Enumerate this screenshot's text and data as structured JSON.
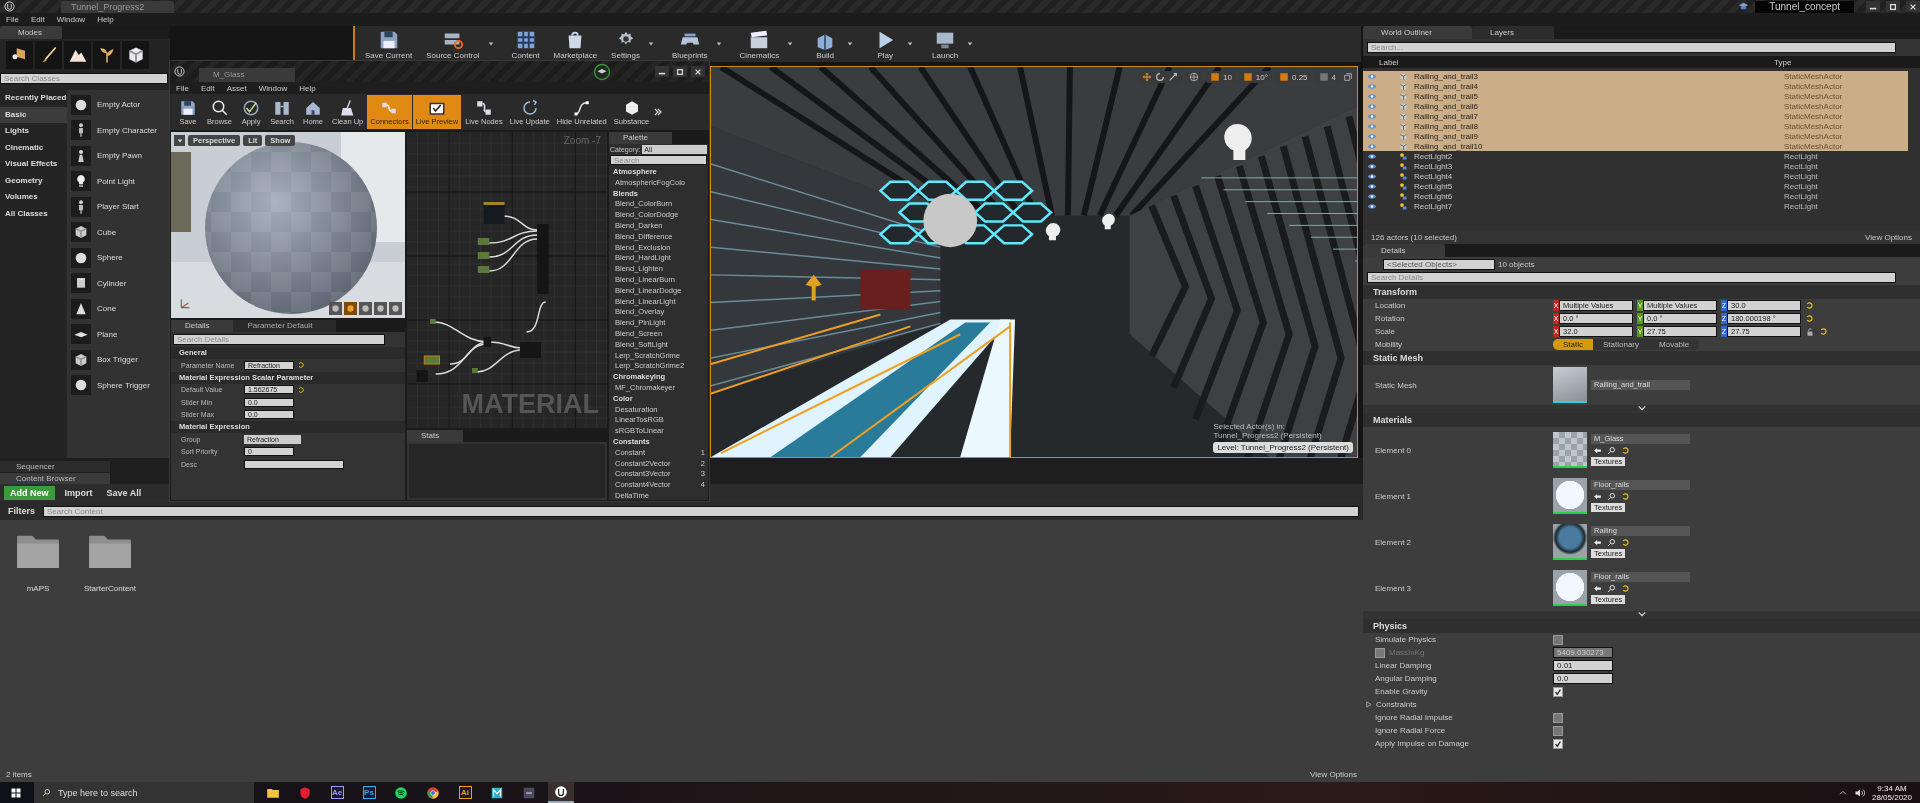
{
  "title_bar": {
    "tab": "Tunnel_Progress2",
    "project": "Tunnel_concept"
  },
  "menu": [
    "File",
    "Edit",
    "Window",
    "Help"
  ],
  "modes": {
    "tab": "Modes",
    "tools": [
      {
        "kind": "place"
      },
      {
        "kind": "paint"
      },
      {
        "kind": "landscape"
      },
      {
        "kind": "foliage"
      },
      {
        "kind": "geometry"
      }
    ],
    "search": {
      "placeholder": "Search Classes"
    },
    "categories": [
      {
        "label": "Recently Placed",
        "selected": false
      },
      {
        "label": "Basic",
        "selected": true
      },
      {
        "label": "Lights",
        "selected": false
      },
      {
        "label": "Cinematic",
        "selected": false
      },
      {
        "label": "Visual Effects",
        "selected": false
      },
      {
        "label": "Geometry",
        "selected": false
      },
      {
        "label": "Volumes",
        "selected": false
      },
      {
        "label": "All Classes",
        "selected": false
      }
    ],
    "items": [
      {
        "label": "Empty Actor",
        "kind": "sphere"
      },
      {
        "label": "Empty Character",
        "kind": "figure"
      },
      {
        "label": "Empty Pawn",
        "kind": "pawn"
      },
      {
        "label": "Point Light",
        "kind": "bulb"
      },
      {
        "label": "Player Start",
        "kind": "figure"
      },
      {
        "label": "Cube",
        "kind": "cube"
      },
      {
        "label": "Sphere",
        "kind": "sphere"
      },
      {
        "label": "Cylinder",
        "kind": "cylinder"
      },
      {
        "label": "Cone",
        "kind": "cone"
      },
      {
        "label": "Plane",
        "kind": "plane"
      },
      {
        "label": "Box Trigger",
        "kind": "cube"
      },
      {
        "label": "Sphere Trigger",
        "kind": "sphere"
      }
    ]
  },
  "toolbar": [
    {
      "label": "Save Current",
      "kind": "save",
      "dropdown": false
    },
    {
      "label": "Source Control",
      "kind": "source-control",
      "dropdown": true
    },
    {
      "label": "Content",
      "kind": "content",
      "dropdown": false
    },
    {
      "label": "Marketplace",
      "kind": "marketplace",
      "dropdown": false
    },
    {
      "label": "Settings",
      "kind": "settings",
      "dropdown": true
    },
    {
      "label": "Blueprints",
      "kind": "blueprints",
      "dropdown": true
    },
    {
      "label": "Cinematics",
      "kind": "cinematics",
      "dropdown": true
    },
    {
      "label": "Build",
      "kind": "build",
      "dropdown": true
    },
    {
      "label": "Play",
      "kind": "play",
      "dropdown": true
    },
    {
      "label": "Launch",
      "kind": "launch",
      "dropdown": true
    }
  ],
  "viewport": {
    "snap_values": [
      "10",
      "10°",
      "0.25",
      "4"
    ],
    "selection_info": "Selected Actor(s) in:",
    "selection_level": "Tunnel_Progress2 (Persistent)",
    "level_badge": "Level:  Tunnel_Progress2 (Persistent)"
  },
  "material_editor": {
    "tab": "M_Glass",
    "menu": [
      "File",
      "Edit",
      "Asset",
      "Window",
      "Help"
    ],
    "toolbar": [
      {
        "label": "Save",
        "kind": "save",
        "on": false
      },
      {
        "label": "Browse",
        "kind": "browse",
        "on": false
      },
      {
        "label": "Apply",
        "kind": "apply",
        "on": false
      },
      {
        "label": "Search",
        "kind": "search",
        "on": false
      },
      {
        "label": "Home",
        "kind": "home",
        "on": false
      },
      {
        "label": "Clean Up",
        "kind": "clean-up",
        "on": false
      },
      {
        "label": "Connectors",
        "kind": "connectors",
        "on": true
      },
      {
        "label": "Live Preview",
        "kind": "live-preview",
        "on": true
      },
      {
        "label": "Live Nodes",
        "kind": "live-nodes",
        "on": false
      },
      {
        "label": "Live Update",
        "kind": "live-update",
        "on": false
      },
      {
        "label": "Hide Unrelated",
        "kind": "hide-unrelated",
        "on": false
      },
      {
        "label": "Substance",
        "kind": "substance",
        "on": false
      }
    ],
    "preview_buttons": [
      "Perspective",
      "Lit",
      "Show"
    ],
    "details_tabs": [
      {
        "label": "Details",
        "selected": true
      },
      {
        "label": "Parameter Default",
        "selected": false
      }
    ],
    "details_search": {
      "placeholder": "Search Details"
    },
    "sections": [
      {
        "title": "General",
        "rows": [
          {
            "label": "Parameter Name",
            "value": "Refraction",
            "kind": "text",
            "reset": true
          }
        ]
      },
      {
        "title": "Material Expression Scalar Parameter",
        "rows": [
          {
            "label": "Default Value",
            "value": "1.562675",
            "kind": "number",
            "reset": true
          },
          {
            "label": "Slider Min",
            "value": "0.0",
            "kind": "number",
            "reset": false
          },
          {
            "label": "Slider Max",
            "value": "0.0",
            "kind": "number",
            "reset": false
          }
        ]
      },
      {
        "title": "Material Expression",
        "rows": [
          {
            "label": "Group",
            "value": "Refraction",
            "kind": "dropdown",
            "reset": false
          },
          {
            "label": "Sort Priority",
            "value": "0",
            "kind": "number",
            "reset": false
          },
          {
            "label": "Desc",
            "kind": "text",
            "reset": false
          }
        ]
      }
    ],
    "graph": {
      "zoom": "Zoom -7",
      "watermark": "MATERIAL"
    },
    "stats_tab": "Stats",
    "palette": {
      "tab": "Palette",
      "category_label": "Category:",
      "category": "All",
      "search": {
        "placeholder": "Search"
      },
      "groups": [
        {
          "title": "Atmosphere",
          "children": [
            {
              "label": "AtmosphericFogColo"
            }
          ]
        },
        {
          "title": "Blends",
          "children": [
            {
              "label": "Blend_ColorBurn"
            },
            {
              "label": "Blend_ColorDodge"
            },
            {
              "label": "Blend_Darken"
            },
            {
              "label": "Blend_Difference"
            },
            {
              "label": "Blend_Exclusion"
            },
            {
              "label": "Blend_HardLight"
            },
            {
              "label": "Blend_Lighten"
            },
            {
              "label": "Blend_LinearBurn"
            },
            {
              "label": "Blend_LinearDodge"
            },
            {
              "label": "Blend_LinearLight"
            },
            {
              "label": "Blend_Overlay"
            },
            {
              "label": "Blend_PinLight"
            },
            {
              "label": "Blend_Screen"
            },
            {
              "label": "Blend_SoftLight"
            },
            {
              "label": "Lerp_ScratchGrime"
            },
            {
              "label": "Lerp_ScratchGrime2"
            }
          ]
        },
        {
          "title": "Chromakeying",
          "children": [
            {
              "label": "MF_Chromakeyer"
            }
          ]
        },
        {
          "title": "Color",
          "children": [
            {
              "label": "Desaturation"
            },
            {
              "label": "LinearTosRGB"
            },
            {
              "label": "sRGBToLinear"
            }
          ]
        },
        {
          "title": "Constants",
          "children": [
            {
              "label": "Constant",
              "hotkey": "1"
            },
            {
              "label": "Constant2Vector",
              "hotkey": "2"
            },
            {
              "label": "Constant3Vector",
              "hotkey": "3"
            },
            {
              "label": "Constant4Vector",
              "hotkey": "4"
            },
            {
              "label": "DeltaTime"
            }
          ]
        }
      ]
    }
  },
  "outliner": {
    "tabs": [
      {
        "label": "World Outliner",
        "selected": true
      },
      {
        "label": "Layers",
        "selected": false
      }
    ],
    "search": {
      "placeholder": "Search..."
    },
    "columns": [
      "Label",
      "Type"
    ],
    "rows": [
      {
        "label": "Railing_and_trail3",
        "type": "StaticMeshActor",
        "kind": "mesh",
        "selected": true
      },
      {
        "label": "Railing_and_trail4",
        "type": "StaticMeshActor",
        "kind": "mesh",
        "selected": true
      },
      {
        "label": "Railing_and_trail5",
        "type": "StaticMeshActor",
        "kind": "mesh",
        "selected": true
      },
      {
        "label": "Railing_and_trail6",
        "type": "StaticMeshActor",
        "kind": "mesh",
        "selected": true
      },
      {
        "label": "Railing_and_trail7",
        "type": "StaticMeshActor",
        "kind": "mesh",
        "selected": true
      },
      {
        "label": "Railing_and_trail8",
        "type": "StaticMeshActor",
        "kind": "mesh",
        "selected": true
      },
      {
        "label": "Railing_and_trail9",
        "type": "StaticMeshActor",
        "kind": "mesh",
        "selected": true
      },
      {
        "label": "Railing_and_trail10",
        "type": "StaticMeshActor",
        "kind": "mesh",
        "selected": true
      },
      {
        "label": "RectLight2",
        "type": "RectLight",
        "kind": "light",
        "selected": false
      },
      {
        "label": "RectLight3",
        "type": "RectLight",
        "kind": "light",
        "selected": false
      },
      {
        "label": "RectLight4",
        "type": "RectLight",
        "kind": "light",
        "selected": false
      },
      {
        "label": "RectLight5",
        "type": "RectLight",
        "kind": "light",
        "selected": false
      },
      {
        "label": "RectLight6",
        "type": "RectLight",
        "kind": "light",
        "selected": false
      },
      {
        "label": "RectLight7",
        "type": "RectLight",
        "kind": "light",
        "selected": false
      }
    ],
    "footer": "126 actors (10 selected)",
    "view_options": "View Options"
  },
  "details": {
    "tab": "Details",
    "selection": "<Selected Objects>",
    "count": "10 objects",
    "search": {
      "placeholder": "Search Details"
    },
    "transform": {
      "title": "Transform",
      "rows": [
        {
          "label": "Location",
          "lock": false,
          "values": [
            {
              "axis": "X",
              "value": "Multiple Values"
            },
            {
              "axis": "Y",
              "value": "Multiple Values"
            },
            {
              "axis": "Z",
              "value": "30.0"
            }
          ]
        },
        {
          "label": "Rotation",
          "lock": false,
          "values": [
            {
              "axis": "X",
              "value": "0.0 °"
            },
            {
              "axis": "Y",
              "value": "0.0 °"
            },
            {
              "axis": "Z",
              "value": "180.000198 °"
            }
          ]
        },
        {
          "label": "Scale",
          "lock": true,
          "values": [
            {
              "axis": "X",
              "value": "32.0"
            },
            {
              "axis": "Y",
              "value": "27.75"
            },
            {
              "axis": "Z",
              "value": "27.75"
            }
          ]
        }
      ],
      "mobility_label": "Mobility",
      "mobility": [
        {
          "label": "Static",
          "selected": true
        },
        {
          "label": "Stationary",
          "selected": false
        },
        {
          "label": "Movable",
          "selected": false
        }
      ]
    },
    "static_mesh": {
      "title": "Static Mesh",
      "label": "Static Mesh",
      "value": "Railing_and_trail"
    },
    "materials": {
      "title": "Materials",
      "elements": [
        {
          "label": "Element 0",
          "value": "M_Glass",
          "kind": "checker",
          "button": "Textures"
        },
        {
          "label": "Element 1",
          "value": "Floor_rails",
          "kind": "white",
          "button": "Textures"
        },
        {
          "label": "Element 2",
          "value": "Railing",
          "kind": "dark",
          "button": "Textures"
        },
        {
          "label": "Element 3",
          "value": "Floor_rails",
          "kind": "white",
          "button": "Textures"
        }
      ]
    },
    "physics": {
      "title": "Physics",
      "rows": [
        {
          "label": "Simulate Physics",
          "kind": "checkbox",
          "checked": false
        },
        {
          "label": "MassInKg",
          "kind": "override",
          "checked": false,
          "value": "5409.030273"
        },
        {
          "label": "Linear Damping",
          "kind": "number",
          "value": "0.01"
        },
        {
          "label": "Angular Damping",
          "kind": "number",
          "value": "0.0"
        },
        {
          "label": "Enable Gravity",
          "kind": "checkbox",
          "checked": true
        },
        {
          "label": "Constraints",
          "kind": "group",
          "expanded": false
        },
        {
          "label": "Ignore Radial Impulse",
          "kind": "checkbox",
          "checked": false
        },
        {
          "label": "Ignore Radial Force",
          "kind": "checkbox",
          "checked": false
        },
        {
          "label": "Apply Impulse on Damage",
          "kind": "checkbox",
          "checked": true
        }
      ]
    }
  },
  "content_browser": {
    "tabs": [
      {
        "label": "Sequencer",
        "selected": false
      },
      {
        "label": "Content Browser",
        "selected": true
      }
    ],
    "add_new": "Add New",
    "import": "Import",
    "save_all": "Save All",
    "filters": "Filters",
    "search": {
      "placeholder": "Search Content"
    },
    "folders": [
      "mAPS",
      "StarterContent"
    ],
    "count": "2 items",
    "view_options": "View Options"
  },
  "taskbar": {
    "search": {
      "placeholder": "Type here to search"
    },
    "apps": [
      {
        "kind": "folder",
        "selected": false
      },
      {
        "kind": "shield",
        "selected": false
      },
      {
        "kind": "letters",
        "text": "Ae",
        "color": "#9999ff",
        "selected": false
      },
      {
        "kind": "letters",
        "text": "Ps",
        "color": "#31a8ff",
        "selected": false
      },
      {
        "kind": "spotify",
        "selected": false
      },
      {
        "kind": "chrome",
        "selected": false
      },
      {
        "kind": "letters",
        "text": "Ai",
        "color": "#ff9a00",
        "selected": false
      },
      {
        "kind": "m-logo",
        "selected": false
      },
      {
        "kind": "tile",
        "selected": false
      },
      {
        "kind": "unreal",
        "selected": true
      }
    ],
    "time": "9:34 AM",
    "date": "28/05/2020"
  }
}
